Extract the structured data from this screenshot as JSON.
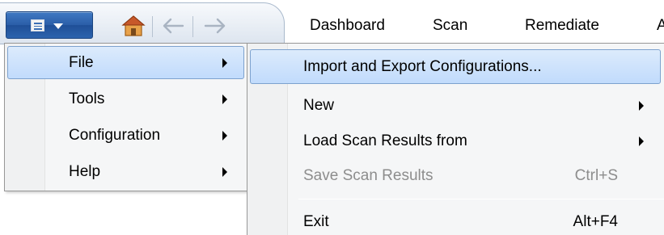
{
  "toolbar": {
    "app_menu_icon": "document-list-icon",
    "app_menu_caret": "caret-down-icon",
    "home_icon": "home-icon",
    "back_icon": "back-arrow-icon",
    "forward_icon": "forward-arrow-icon",
    "tabs": [
      {
        "label": "Dashboard"
      },
      {
        "label": "Scan"
      },
      {
        "label": "Remediate"
      },
      {
        "label": "A"
      }
    ]
  },
  "main_menu": {
    "items": [
      {
        "label": "File",
        "has_submenu": true,
        "highlighted": true
      },
      {
        "label": "Tools",
        "has_submenu": true
      },
      {
        "label": "Configuration",
        "has_submenu": true
      },
      {
        "label": "Help",
        "has_submenu": true
      }
    ]
  },
  "file_submenu": {
    "items": [
      {
        "label": "Import and Export Configurations...",
        "shortcut": "",
        "highlighted": true
      },
      {
        "label": "New",
        "shortcut": "",
        "has_submenu": true
      },
      {
        "label": "Load Scan Results from",
        "shortcut": "",
        "has_submenu": true
      },
      {
        "label": "Save Scan Results",
        "shortcut": "Ctrl+S",
        "disabled": true
      },
      {
        "label": "Exit",
        "shortcut": "Alt+F4"
      }
    ]
  },
  "colors": {
    "highlight_fill": "#c1dbfc",
    "highlight_border": "#7da2ce",
    "app_button": "#2b5ea8",
    "disabled_text": "#8d8d8d"
  }
}
